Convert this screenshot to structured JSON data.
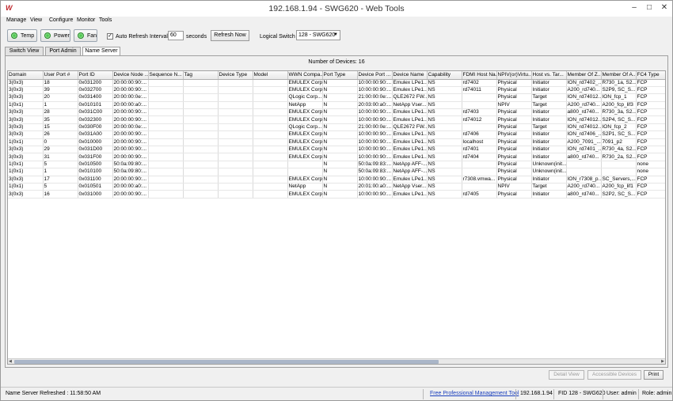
{
  "window": {
    "title": "192.168.1.94 - SWG620 - Web Tools",
    "app_logo_text": "W"
  },
  "menu": [
    "Manage",
    "View",
    "Configure",
    "Monitor",
    "Tools"
  ],
  "toolbar": {
    "status_buttons": [
      "Temp",
      "Power",
      "Fan"
    ],
    "auto_refresh_label": "Auto Refresh",
    "auto_refresh_checked": true,
    "interval_label": "Interval",
    "interval_value": "60",
    "seconds_label": "seconds",
    "refresh_now_label": "Refresh Now",
    "logical_switch_label": "Logical Switch",
    "logical_switch_value": "128 - SWG620"
  },
  "tabs": [
    "Switch View",
    "Port Admin",
    "Name Server"
  ],
  "active_tab": "Name Server",
  "number_of_devices": "Number of Devices:  16",
  "table": {
    "columns": [
      "Domain",
      "User Port #",
      "Port ID",
      "Device Node ...",
      "Sequence N...",
      "Tag",
      "Device Type",
      "Model",
      "WWN Compa...",
      "Port Type",
      "Device Port ...",
      "Device Name",
      "Capability",
      "FDMI Host Na...",
      "NPIV(or)Virtu...",
      "Host vs. Tar...",
      "Member Of Z...",
      "Member Of A...",
      "FC4 Type"
    ],
    "rows": [
      [
        "3(0x3)",
        "18",
        "0x031200",
        "20:00:00:90:...",
        "",
        "",
        "",
        "",
        "EMULEX Corp",
        "N",
        "10:00:00:90:...",
        "Emulex LPe1...",
        "NS",
        "rd7402",
        "Physical",
        "Initiator",
        "ION_rd7402_...",
        "R730_1a, S2...",
        "FCP"
      ],
      [
        "3(0x3)",
        "39",
        "0x032700",
        "20:00:00:90:...",
        "",
        "",
        "",
        "",
        "EMULEX Corp",
        "N",
        "10:00:00:90:...",
        "Emulex LPe1...",
        "NS",
        "rd74011",
        "Physical",
        "Initiator",
        "A200_rd740...",
        "S2P9, SC_S...",
        "FCP"
      ],
      [
        "3(0x3)",
        "20",
        "0x031400",
        "20:00:00:0e:...",
        "",
        "",
        "",
        "",
        "QLogic Corp...",
        "N",
        "21:00:00:0e:...",
        "QLE2672 FW...",
        "NS",
        "",
        "Physical",
        "Target",
        "ION_rd74012...",
        "ION_fcp_1",
        "FCP"
      ],
      [
        "1(0x1)",
        "1",
        "0x010101",
        "20:00:00:a0:...",
        "",
        "",
        "",
        "",
        "NetApp",
        "N",
        "20:03:00:a0:...",
        "NetApp Vser...",
        "NS",
        "",
        "NPIV",
        "Target",
        "A200_rd740...",
        "A200_fcp_lif3",
        "FCP"
      ],
      [
        "3(0x3)",
        "28",
        "0x031C00",
        "20:00:00:90:...",
        "",
        "",
        "",
        "",
        "EMULEX Corp",
        "N",
        "10:00:00:90:...",
        "Emulex LPe1...",
        "NS",
        "rd7403",
        "Physical",
        "Initiator",
        "a800_rd740...",
        "R730_3a, S2...",
        "FCP"
      ],
      [
        "3(0x3)",
        "35",
        "0x032300",
        "20:00:00:90:...",
        "",
        "",
        "",
        "",
        "EMULEX Corp",
        "N",
        "10:00:00:90:...",
        "Emulex LPe1...",
        "NS",
        "rd74012",
        "Physical",
        "Initiator",
        "ION_rd74012...",
        "S2P4, SC_S...",
        "FCP"
      ],
      [
        "3(0x3)",
        "15",
        "0x030F00",
        "20:00:00:0e:...",
        "",
        "",
        "",
        "",
        "QLogic Corp...",
        "N",
        "21:00:00:0e:...",
        "QLE2672 FW...",
        "NS",
        "",
        "Physical",
        "Target",
        "ION_rd74012...",
        "ION_fcp_2",
        "FCP"
      ],
      [
        "3(0x3)",
        "26",
        "0x031A00",
        "20:00:00:90:...",
        "",
        "",
        "",
        "",
        "EMULEX Corp",
        "N",
        "10:00:00:90:...",
        "Emulex LPe1...",
        "NS",
        "rd7406",
        "Physical",
        "Initiator",
        "ION_rd7406_...",
        "S2P1, SC_S...",
        "FCP"
      ],
      [
        "1(0x1)",
        "0",
        "0x010000",
        "20:00:00:90:...",
        "",
        "",
        "",
        "",
        "EMULEX Corp",
        "N",
        "10:00:00:90:...",
        "Emulex LPe1...",
        "NS",
        "localhost",
        "Physical",
        "Initiator",
        "A200_7091_...",
        "7091_p2",
        "FCP"
      ],
      [
        "3(0x3)",
        "29",
        "0x031D00",
        "20:00:00:90:...",
        "",
        "",
        "",
        "",
        "EMULEX Corp",
        "N",
        "10:00:00:90:...",
        "Emulex LPe1...",
        "NS",
        "rd7401",
        "Physical",
        "Initiator",
        "ION_rd7401_...",
        "R730_4a, S2...",
        "FCP"
      ],
      [
        "3(0x3)",
        "31",
        "0x031F00",
        "20:00:00:90:...",
        "",
        "",
        "",
        "",
        "EMULEX Corp",
        "N",
        "10:00:00:90:...",
        "Emulex LPe1...",
        "NS",
        "rd7404",
        "Physical",
        "Initiator",
        "a800_rd740...",
        "R730_2a, S2...",
        "FCP"
      ],
      [
        "1(0x1)",
        "5",
        "0x010500",
        "50:0a:09:80:...",
        "",
        "",
        "",
        "",
        "",
        "N",
        "50:0a:09:83:...",
        "NetApp AFF-...",
        "NS",
        "",
        "Physical",
        "Unknown(init...",
        "",
        "",
        "none"
      ],
      [
        "1(0x1)",
        "1",
        "0x010100",
        "50:0a:09:80:...",
        "",
        "",
        "",
        "",
        "",
        "N",
        "50:0a:09:83:...",
        "NetApp AFF-...",
        "NS",
        "",
        "Physical",
        "Unknown(init...",
        "",
        "",
        "none"
      ],
      [
        "3(0x3)",
        "17",
        "0x031100",
        "20:00:00:90:...",
        "",
        "",
        "",
        "",
        "EMULEX Corp",
        "N",
        "10:00:00:90:...",
        "Emulex LPe1...",
        "NS",
        "r7308.vmwa...",
        "Physical",
        "Initiator",
        "ION_r7308_p...",
        "SC_Servers,...",
        "FCP"
      ],
      [
        "1(0x1)",
        "5",
        "0x010501",
        "20:00:00:a0:...",
        "",
        "",
        "",
        "",
        "NetApp",
        "N",
        "20:01:00:a0:...",
        "NetApp Vser...",
        "NS",
        "",
        "NPIV",
        "Target",
        "A200_rd740...",
        "A200_fcp_lif1",
        "FCP"
      ],
      [
        "3(0x3)",
        "16",
        "0x031000",
        "20:00:00:90:...",
        "",
        "",
        "",
        "",
        "EMULEX Corp",
        "N",
        "10:00:00:90:...",
        "Emulex LPe1...",
        "NS",
        "rd7405",
        "Physical",
        "Initiator",
        "a800_rd740...",
        "S2P2, SC_S...",
        "FCP"
      ]
    ]
  },
  "buttons": {
    "detail_view": "Detail View",
    "accessible_devices": "Accessible Devices",
    "print": "Print"
  },
  "statusbar": {
    "refreshed": "Name Server Refreshed : 11:58:50 AM",
    "link": "Free Professional Management Tool",
    "ip": "192.168.1.94",
    "fid": "FID 128 - SWG620",
    "user": "User: admin",
    "role": "Role: admin"
  },
  "colors": {
    "status_ok": "#46c846",
    "link": "#1a3fbd",
    "logo": "#c0282e"
  }
}
